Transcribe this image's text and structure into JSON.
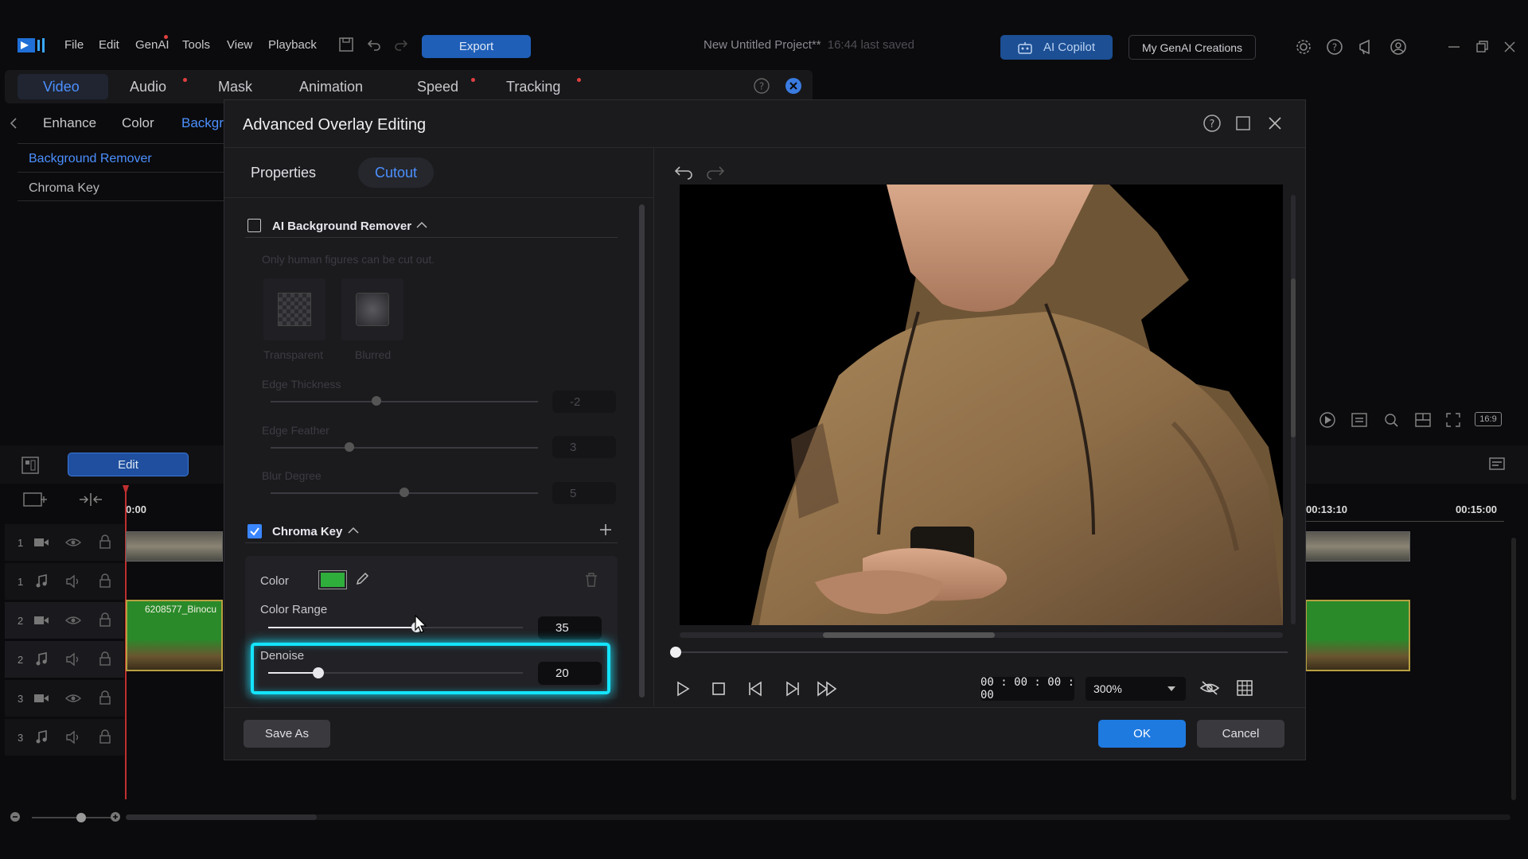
{
  "menu": {
    "items": [
      "File",
      "Edit",
      "GenAI",
      "Tools",
      "View",
      "Playback"
    ],
    "export_label": "Export",
    "project_title": "New Untitled Project**",
    "last_saved": "16:44 last saved",
    "copilot_label": "AI Copilot",
    "creations_label": "My GenAI Creations"
  },
  "edit_tabs": [
    "Video",
    "Audio",
    "Mask",
    "Animation",
    "Speed",
    "Tracking"
  ],
  "sub_tabs": [
    "Enhance",
    "Color",
    "Backgr"
  ],
  "left_list": [
    "Background Remover",
    "Chroma Key"
  ],
  "timeline": {
    "edit_label": "Edit",
    "time_start": "0:00",
    "time_mark_1": "00:13:10",
    "time_mark_2": "00:15:00",
    "clip_label": "6208577_Binocu",
    "track_numbers": [
      "1",
      "1",
      "2",
      "2",
      "3",
      "3"
    ],
    "aspect": "16:9"
  },
  "dialog": {
    "title": "Advanced Overlay Editing",
    "tab_properties": "Properties",
    "tab_cutout": "Cutout",
    "ai_section_title": "AI Background Remover",
    "ai_hint": "Only human figures can be cut out.",
    "transparent_label": "Transparent",
    "blurred_label": "Blurred",
    "edge_thickness_label": "Edge Thickness",
    "edge_thickness_value": "-2",
    "edge_feather_label": "Edge Feather",
    "edge_feather_value": "3",
    "blur_degree_label": "Blur Degree",
    "blur_degree_value": "5",
    "chroma_title": "Chroma Key",
    "color_label": "Color",
    "key_color": "#2fae3c",
    "color_range_label": "Color Range",
    "color_range_value": "35",
    "denoise_label": "Denoise",
    "denoise_value": "20",
    "timecode": "00 : 00 : 00 : 00",
    "zoom": "300%",
    "save_as_label": "Save As",
    "ok_label": "OK",
    "cancel_label": "Cancel"
  },
  "colors": {
    "accent": "#1f6fd6",
    "highlight": "#14e4ff"
  }
}
